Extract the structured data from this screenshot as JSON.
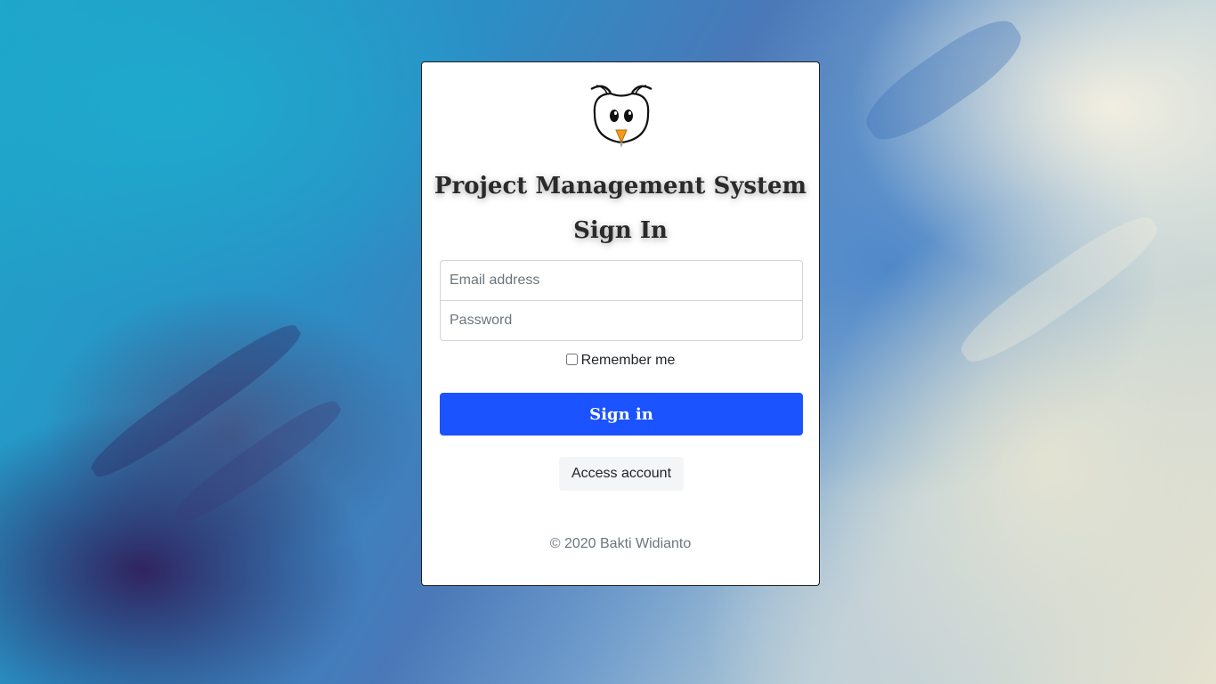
{
  "app": {
    "title": "Project Management System",
    "subtitle": "Sign In"
  },
  "form": {
    "email_placeholder": "Email address",
    "email_value": "",
    "password_placeholder": "Password",
    "password_value": "",
    "remember_label": "Remember me",
    "remember_checked": false,
    "signin_label": "Sign in",
    "access_label": "Access account"
  },
  "footer": {
    "text": "© 2020 Bakti Widianto"
  },
  "colors": {
    "primary": "#1a53ff",
    "card_background": "#ffffff",
    "footer_text": "#6c757d"
  },
  "icons": {
    "logo": "owl-logo-icon"
  }
}
